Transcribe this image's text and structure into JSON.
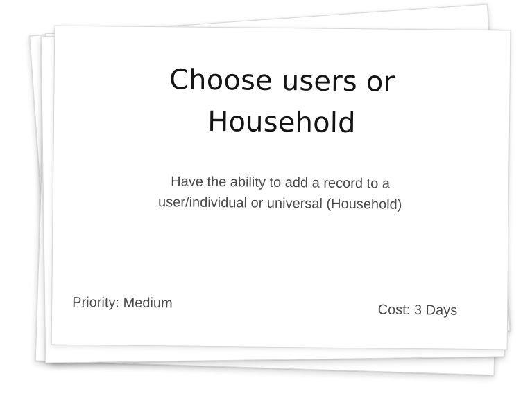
{
  "card": {
    "title": "Choose users or\nHousehold",
    "description": "Have the ability to add a record to a\nuser/individual or universal (Household)",
    "priority": "Priority: Medium",
    "cost": "Cost: 3 Days"
  }
}
